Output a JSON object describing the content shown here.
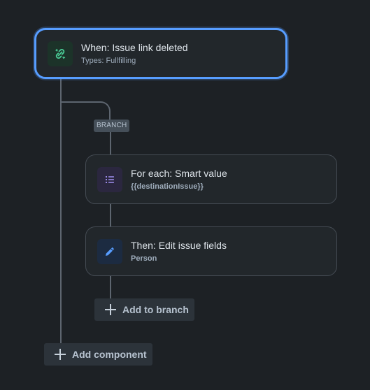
{
  "trigger": {
    "title": "When: Issue link deleted",
    "subtitle": "Types: Fullfilling",
    "icon": "link-broken-icon"
  },
  "branch": {
    "badge": "BRANCH"
  },
  "actions": [
    {
      "title": "For each: Smart value",
      "subtitle": "{{destinationIssue}}",
      "icon": "list-icon"
    },
    {
      "title": "Then: Edit issue fields",
      "subtitle": "Person",
      "icon": "pencil-icon"
    }
  ],
  "buttons": {
    "add_to_branch": "Add to branch",
    "add_component": "Add component"
  },
  "colors": {
    "background": "#1d2125",
    "card": "#22272b",
    "selected_border": "#579dff",
    "trigger_icon_bg": "#1c3329",
    "trigger_icon": "#4bce97",
    "list_icon_bg": "#2b273f",
    "list_icon": "#9f8fef",
    "pencil_icon_bg": "#1c2b41",
    "pencil_icon": "#579dff"
  }
}
